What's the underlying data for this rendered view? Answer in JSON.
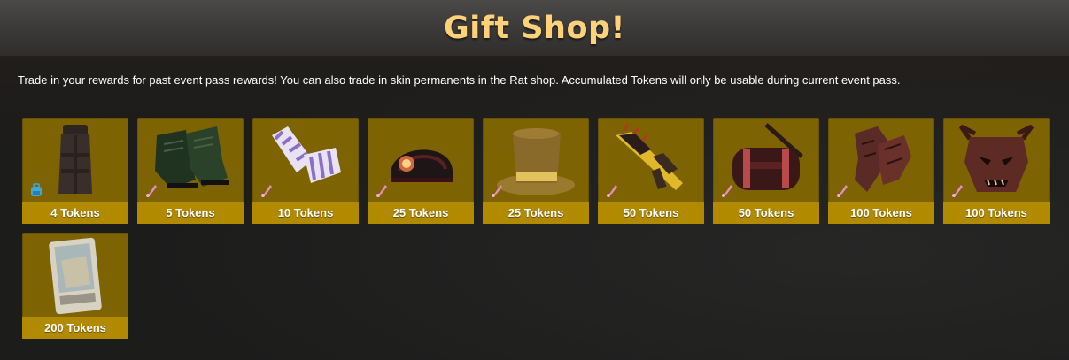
{
  "shop": {
    "title": "Gift Shop!",
    "description": "Trade in your rewards for past event pass rewards! You can also trade in skin permanents in the Rat shop. Accumulated Tokens will only be usable during current event pass."
  },
  "items": [
    {
      "item_icon": "dark-coat-icon",
      "badge_icon": "backpack-icon",
      "price": "4 Tokens"
    },
    {
      "item_icon": "green-boots-icon",
      "badge_icon": "brush-icon",
      "price": "5 Tokens"
    },
    {
      "item_icon": "striped-gloves-icon",
      "badge_icon": "brush-icon",
      "price": "10 Tokens"
    },
    {
      "item_icon": "miner-helmet-icon",
      "badge_icon": "brush-icon",
      "price": "25 Tokens"
    },
    {
      "item_icon": "top-hat-icon",
      "badge_icon": "brush-icon",
      "price": "25 Tokens"
    },
    {
      "item_icon": "spiked-gun-icon",
      "badge_icon": "brush-icon",
      "price": "50 Tokens"
    },
    {
      "item_icon": "duffel-bag-icon",
      "badge_icon": "brush-icon",
      "price": "50 Tokens"
    },
    {
      "item_icon": "rock-gauntlets-icon",
      "badge_icon": "brush-icon",
      "price": "100 Tokens"
    },
    {
      "item_icon": "demon-mask-icon",
      "badge_icon": "brush-icon",
      "price": "100 Tokens"
    },
    {
      "item_icon": "unlock-card-icon",
      "badge_icon": "",
      "price": "200 Tokens"
    }
  ],
  "colors": {
    "title": "#ffd27a",
    "card": "#7d6302",
    "price_bar": "#b28a00",
    "header": "#3a3938"
  }
}
